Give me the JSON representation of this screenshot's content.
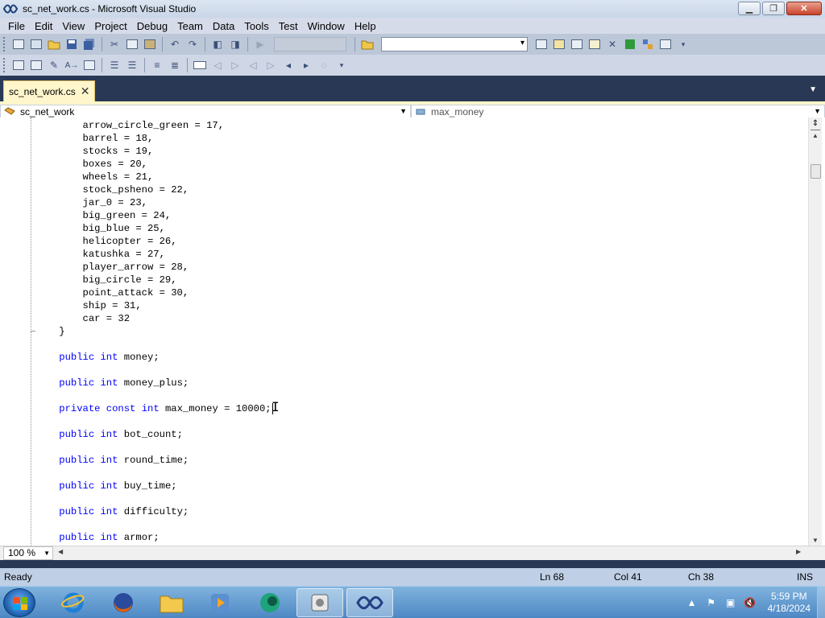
{
  "window": {
    "title": "sc_net_work.cs - Microsoft Visual Studio",
    "controls": {
      "minimize": "▁",
      "maximize": "❐",
      "close": "✕"
    }
  },
  "menu": [
    "File",
    "Edit",
    "View",
    "Project",
    "Debug",
    "Team",
    "Data",
    "Tools",
    "Test",
    "Window",
    "Help"
  ],
  "document_tab": {
    "label": "sc_net_work.cs",
    "close": "✕"
  },
  "navigation": {
    "type_combo": "sc_net_work",
    "member_combo": "max_money"
  },
  "editor": {
    "lines": [
      [
        {
          "t": "        arrow_circle_green = 17,"
        }
      ],
      [
        {
          "t": "        barrel = 18,"
        }
      ],
      [
        {
          "t": "        stocks = 19,"
        }
      ],
      [
        {
          "t": "        boxes = 20,"
        }
      ],
      [
        {
          "t": "        wheels = 21,"
        }
      ],
      [
        {
          "t": "        stock_psheno = 22,"
        }
      ],
      [
        {
          "t": "        jar_0 = 23,"
        }
      ],
      [
        {
          "t": "        big_green = 24,"
        }
      ],
      [
        {
          "t": "        big_blue = 25,"
        }
      ],
      [
        {
          "t": "        helicopter = 26,"
        }
      ],
      [
        {
          "t": "        katushka = 27,"
        }
      ],
      [
        {
          "t": "        player_arrow = 28,"
        }
      ],
      [
        {
          "t": "        big_circle = 29,"
        }
      ],
      [
        {
          "t": "        point_attack = 30,"
        }
      ],
      [
        {
          "t": "        ship = 31,"
        }
      ],
      [
        {
          "t": "        car = 32"
        }
      ],
      [
        {
          "t": "    }"
        }
      ],
      [
        {
          "t": ""
        }
      ],
      [
        {
          "t": "    "
        },
        {
          "t": "public",
          "k": 1
        },
        {
          "t": " "
        },
        {
          "t": "int",
          "k": 1
        },
        {
          "t": " money;"
        }
      ],
      [
        {
          "t": ""
        }
      ],
      [
        {
          "t": "    "
        },
        {
          "t": "public",
          "k": 1
        },
        {
          "t": " "
        },
        {
          "t": "int",
          "k": 1
        },
        {
          "t": " money_plus;"
        }
      ],
      [
        {
          "t": ""
        }
      ],
      [
        {
          "t": "    "
        },
        {
          "t": "private",
          "k": 1
        },
        {
          "t": " "
        },
        {
          "t": "const",
          "k": 1
        },
        {
          "t": " "
        },
        {
          "t": "int",
          "k": 1
        },
        {
          "t": " max_money = 10000;"
        },
        {
          "cursor": 1
        }
      ],
      [
        {
          "t": ""
        }
      ],
      [
        {
          "t": "    "
        },
        {
          "t": "public",
          "k": 1
        },
        {
          "t": " "
        },
        {
          "t": "int",
          "k": 1
        },
        {
          "t": " bot_count;"
        }
      ],
      [
        {
          "t": ""
        }
      ],
      [
        {
          "t": "    "
        },
        {
          "t": "public",
          "k": 1
        },
        {
          "t": " "
        },
        {
          "t": "int",
          "k": 1
        },
        {
          "t": " round_time;"
        }
      ],
      [
        {
          "t": ""
        }
      ],
      [
        {
          "t": "    "
        },
        {
          "t": "public",
          "k": 1
        },
        {
          "t": " "
        },
        {
          "t": "int",
          "k": 1
        },
        {
          "t": " buy_time;"
        }
      ],
      [
        {
          "t": ""
        }
      ],
      [
        {
          "t": "    "
        },
        {
          "t": "public",
          "k": 1
        },
        {
          "t": " "
        },
        {
          "t": "int",
          "k": 1
        },
        {
          "t": " difficulty;"
        }
      ],
      [
        {
          "t": ""
        }
      ],
      [
        {
          "t": "    "
        },
        {
          "t": "public",
          "k": 1
        },
        {
          "t": " "
        },
        {
          "t": "int",
          "k": 1
        },
        {
          "t": " armor;"
        }
      ]
    ],
    "keyword_color": "#0000ff",
    "zoom": "100 %"
  },
  "status": {
    "text": "Ready",
    "line": "Ln 68",
    "col": "Col 41",
    "ch": "Ch 38",
    "mode": "INS"
  },
  "taskbar": {
    "apps": [
      "internet-explorer",
      "firefox",
      "file-explorer",
      "media-player",
      "browser-green",
      "app-grey",
      "visual-studio"
    ],
    "clock_time": "5:59 PM",
    "clock_date": "4/18/2024"
  }
}
